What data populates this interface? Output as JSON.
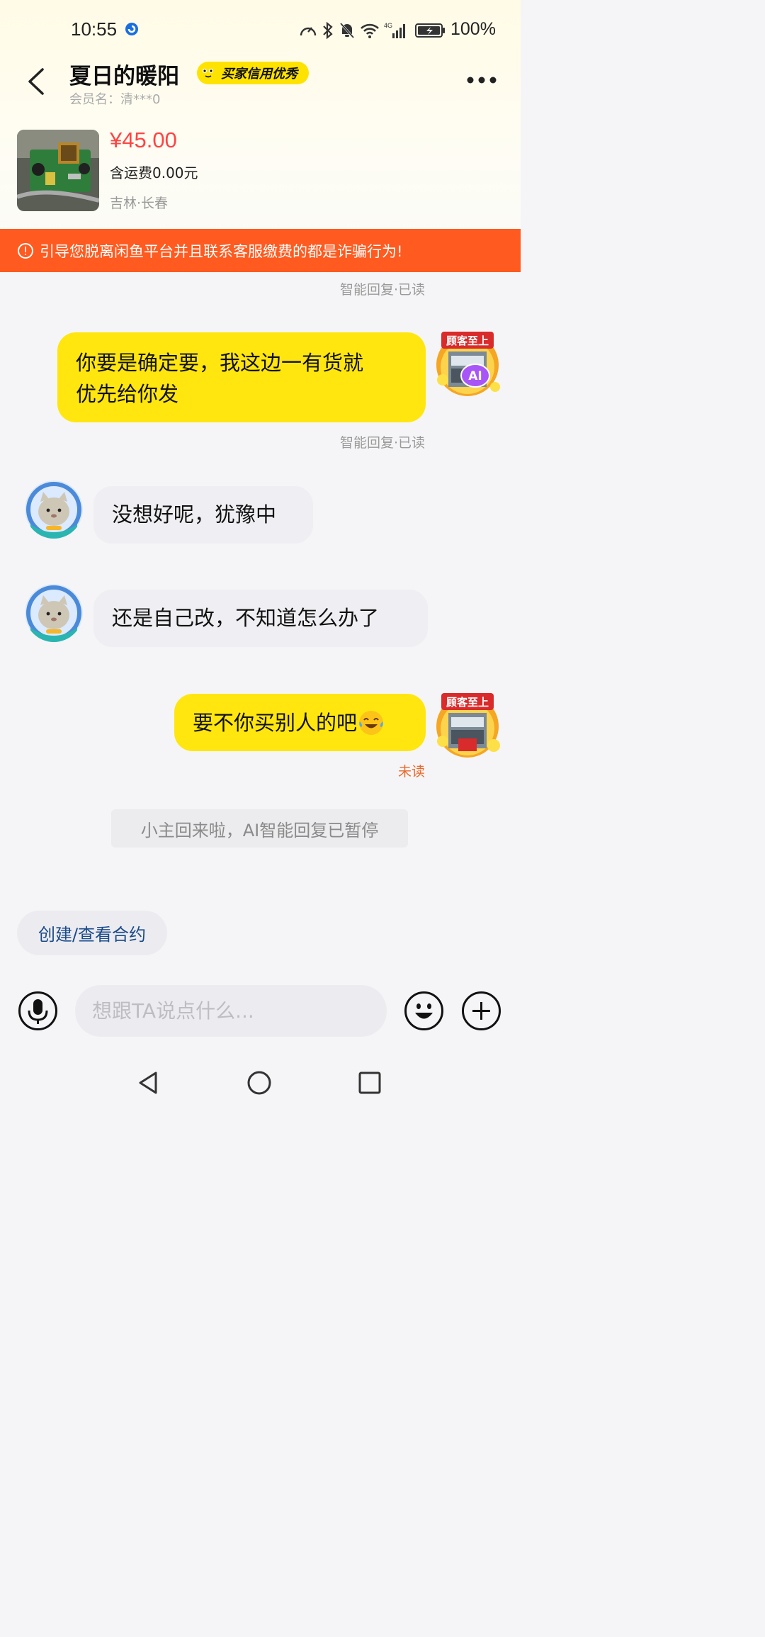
{
  "status_bar": {
    "time": "10:55",
    "network": "4G",
    "battery": "100%"
  },
  "header": {
    "seller_name": "夏日的暖阳",
    "badge": "买家信用优秀",
    "member_label": "会员名：清***0"
  },
  "product": {
    "price": "¥45.00",
    "shipping": "含运费0.00元",
    "location": "吉林·长春"
  },
  "warning": "引导您脱离闲鱼平台并且联系客服缴费的都是诈骗行为!",
  "messages": [
    {
      "meta": "智能回复·已读"
    },
    {
      "text_line1": "你要是确定要，我这边一有货就",
      "text_line2": "优先给你发",
      "meta": "智能回复·已读",
      "avatar_label": "顾客至上",
      "ai_badge": "AI"
    },
    {
      "text": "没想好呢，犹豫中"
    },
    {
      "text": "还是自己改，不知道怎么办了"
    },
    {
      "text": "要不你买别人的吧",
      "meta": "未读",
      "avatar_label": "顾客至上"
    }
  ],
  "system_note": "小主回来啦，AI智能回复已暂停",
  "contract_button": "创建/查看合约",
  "input": {
    "placeholder": "想跟TA说点什么..."
  },
  "colors": {
    "accent_yellow": "#ffe60f",
    "warning_orange": "#ff5a1f",
    "price_red": "#ff4444"
  }
}
